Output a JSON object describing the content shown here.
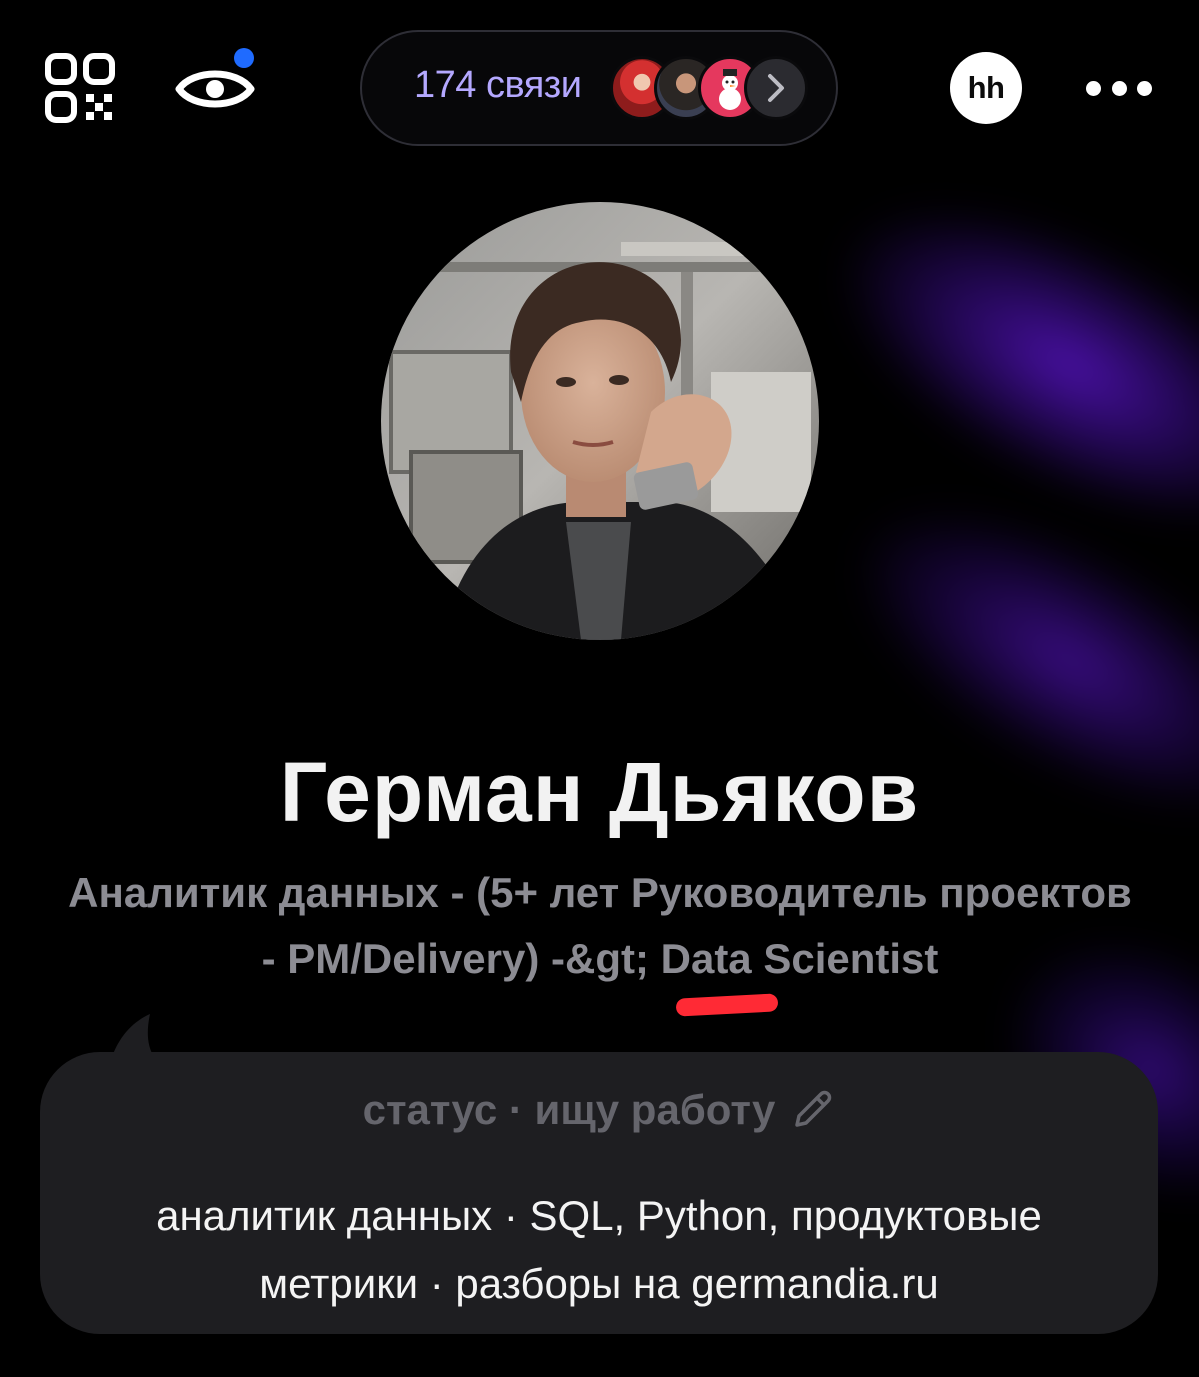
{
  "header": {
    "connections_label": "174 связи",
    "hh_badge": "hh",
    "icons": [
      "qr-code-icon",
      "eye-icon",
      "chevron-right-icon",
      "more-icon"
    ],
    "notification_color": "#1f6bff",
    "connection_avatars": [
      "connection-avatar-1",
      "connection-avatar-2",
      "connection-avatar-3"
    ]
  },
  "profile": {
    "name": "Герман Дьяков",
    "headline": "Аналитик данных - (5+ лет Руководитель проектов  - PM/Delivery) -&gt; Data Scientist"
  },
  "status": {
    "label": "статус · ищу работу",
    "text": "аналитик данных · SQL, Python, продуктовые метрики · разборы на germandia.ru"
  },
  "colors": {
    "background": "#000000",
    "accent_purple": "#b4a8ff",
    "glow": "#6216dc",
    "highlight_red": "#ff2a35",
    "card": "#1e1e21"
  }
}
